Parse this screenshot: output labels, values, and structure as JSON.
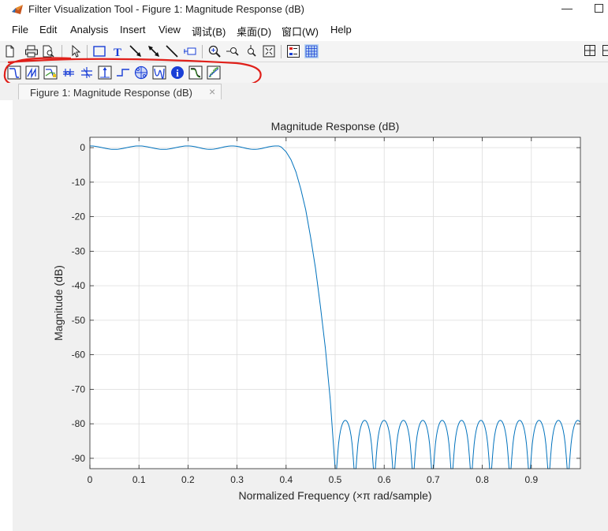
{
  "window": {
    "title": "Filter Visualization Tool - Figure 1: Magnitude Response (dB)",
    "minimize_glyph": "—",
    "maximize_icon": "maximize-icon"
  },
  "menu": [
    {
      "label": "File"
    },
    {
      "label": "Edit"
    },
    {
      "label": "Analysis"
    },
    {
      "label": "Insert"
    },
    {
      "label": "View"
    },
    {
      "label": "调试(B)"
    },
    {
      "label": "桌面(D)"
    },
    {
      "label": "窗口(W)"
    },
    {
      "label": "Help"
    }
  ],
  "toolbar": {
    "icons": [
      "new-icon",
      "print-icon",
      "print-preview-icon",
      "pointer-icon",
      "rectangle-icon",
      "text-icon",
      "arrow-icon",
      "double-arrow-icon",
      "line-icon",
      "data-tip-icon",
      "zoom-in-icon",
      "zoom-x-icon",
      "zoom-y-icon",
      "full-view-icon",
      "legend-icon",
      "grid-icon"
    ],
    "right_icons": [
      "tile-icon",
      "dock-icon"
    ],
    "text_icon_glyph": "T"
  },
  "analysis_toolbar": {
    "icons": [
      "magnitude-response-icon",
      "phase-response-icon",
      "magnitude-phase-icon",
      "group-delay-icon",
      "phase-delay-icon",
      "impulse-response-icon",
      "step-response-icon",
      "pole-zero-icon",
      "coefficients-icon",
      "filter-info-icon",
      "magnitude-estimate-icon",
      "round-off-noise-icon"
    ],
    "info_glyph": "i"
  },
  "tab": {
    "label": "Figure 1: Magnitude Response (dB)",
    "close_glyph": "×"
  },
  "colors": {
    "line": "#0072bd",
    "grid": "#dcdcdc",
    "annotation": "#e0201a",
    "toolbar_blue": "#1a3fd6"
  },
  "chart_data": {
    "type": "line",
    "title": "Magnitude Response (dB)",
    "xlabel": "Normalized Frequency (×π rad/sample)",
    "ylabel": "Magnitude (dB)",
    "xlim": [
      0,
      1
    ],
    "ylim": [
      -93,
      3
    ],
    "xticks": [
      0,
      0.1,
      0.2,
      0.3,
      0.4,
      0.5,
      0.6,
      0.7,
      0.8,
      0.9
    ],
    "xtick_labels": [
      "0",
      "0.1",
      "0.2",
      "0.3",
      "0.4",
      "0.5",
      "0.6",
      "0.7",
      "0.8",
      "0.9"
    ],
    "yticks": [
      0,
      -10,
      -20,
      -30,
      -40,
      -50,
      -60,
      -70,
      -80,
      -90
    ],
    "ytick_labels": [
      "0",
      "-10",
      "-20",
      "-30",
      "-40",
      "-50",
      "-60",
      "-70",
      "-80",
      "-90"
    ],
    "grid": true,
    "series": [
      {
        "passband": {
          "x_end": 0.385,
          "ripple_db": 0.5,
          "peaks": [
            0,
            0.1,
            0.2,
            0.29,
            0.38
          ]
        },
        "transition": {
          "x": [
            0.385,
            0.39,
            0.4,
            0.41,
            0.42,
            0.43,
            0.44,
            0.45,
            0.46,
            0.47,
            0.48,
            0.49,
            0.5
          ],
          "y": [
            0.5,
            0.2,
            -1.2,
            -3.5,
            -7,
            -12,
            -18,
            -26,
            -35,
            -46,
            -58,
            -73,
            -93
          ]
        },
        "stopband": {
          "level_db": -79,
          "first_null": 0.501,
          "null_spacing": 0.0395,
          "nulls": 13
        }
      }
    ]
  }
}
